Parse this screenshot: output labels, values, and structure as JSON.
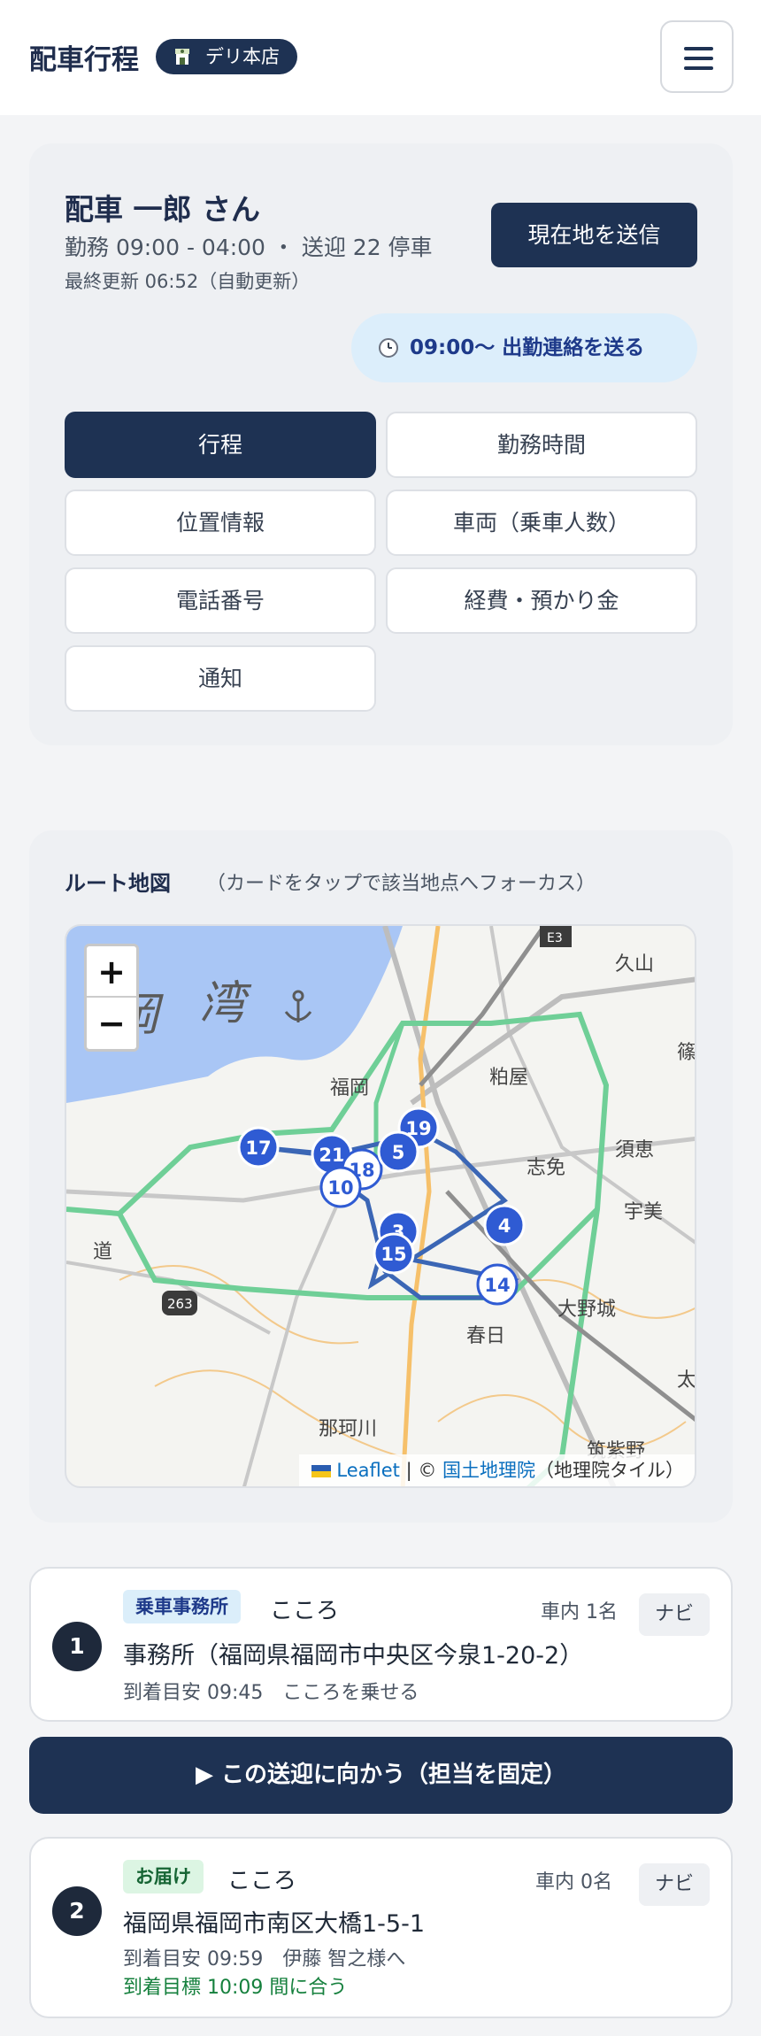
{
  "header": {
    "title": "配車行程",
    "store": "デリ本店"
  },
  "profile": {
    "name": "配車 一郎 さん",
    "shift": "勤務 09:00 - 04:00 ・ 送迎 22 停車",
    "updated": "最終更新 06:52（自動更新）",
    "send_location_label": "現在地を送信",
    "clock_in_label": "09:00〜 出勤連絡を送る"
  },
  "menu": {
    "items": [
      {
        "label": "行程",
        "active": true
      },
      {
        "label": "勤務時間"
      },
      {
        "label": "位置情報"
      },
      {
        "label": "車両（乗車人数）"
      },
      {
        "label": "電話番号"
      },
      {
        "label": "経費・預かり金"
      },
      {
        "label": "通知"
      }
    ]
  },
  "map": {
    "title": "ルート地図",
    "hint": "（カードをタップで該当地点へフォーカス）",
    "zoom_in": "+",
    "zoom_out": "−",
    "attribution": {
      "leaflet": "Leaflet",
      "separator": " | © ",
      "gsi": "国土地理院",
      "tiles": "（地理院タイル）"
    },
    "labels": {
      "bay": "湾",
      "bay_prefix": "岡",
      "fukuoka": "福岡",
      "kasuya": "粕屋",
      "shime": "志免",
      "sue": "須恵",
      "umi": "宇美",
      "onojo": "大野城",
      "kasuga": "春日",
      "nakagawa": "那珂川",
      "chikushino": "筑紫野",
      "hisayama": "久山",
      "sasaguri": "篠",
      "dazaifu": "太",
      "michi": "道",
      "e3": "E3",
      "r263": "263"
    },
    "markers": [
      "17",
      "21",
      "18",
      "10",
      "19",
      "5",
      "3",
      "15",
      "4",
      "14"
    ]
  },
  "stops": [
    {
      "number": "1",
      "type": "乗車事務所",
      "name": "こころ",
      "count": "車内 1名",
      "navi": "ナビ",
      "address": "事務所（福岡県福岡市中央区今泉1-20-2）",
      "eta": "到着目安 09:45　こころを乗せる"
    },
    {
      "number": "2",
      "type": "お届け",
      "name": "こころ",
      "count": "車内 0名",
      "navi": "ナビ",
      "address": "福岡県福岡市南区大橋1-5-1",
      "eta": "到着目安 09:59　伊藤 智之様へ",
      "target": "到着目標 10:09 間に合う"
    }
  ],
  "go_button": "▶ この送迎に向かう（担当を固定）",
  "colors": {
    "navy": "#1e3253",
    "marker": "#2f5bd3",
    "route": "#3b66b5",
    "expressway": "#6fcf97",
    "water": "#a9c6f5"
  }
}
